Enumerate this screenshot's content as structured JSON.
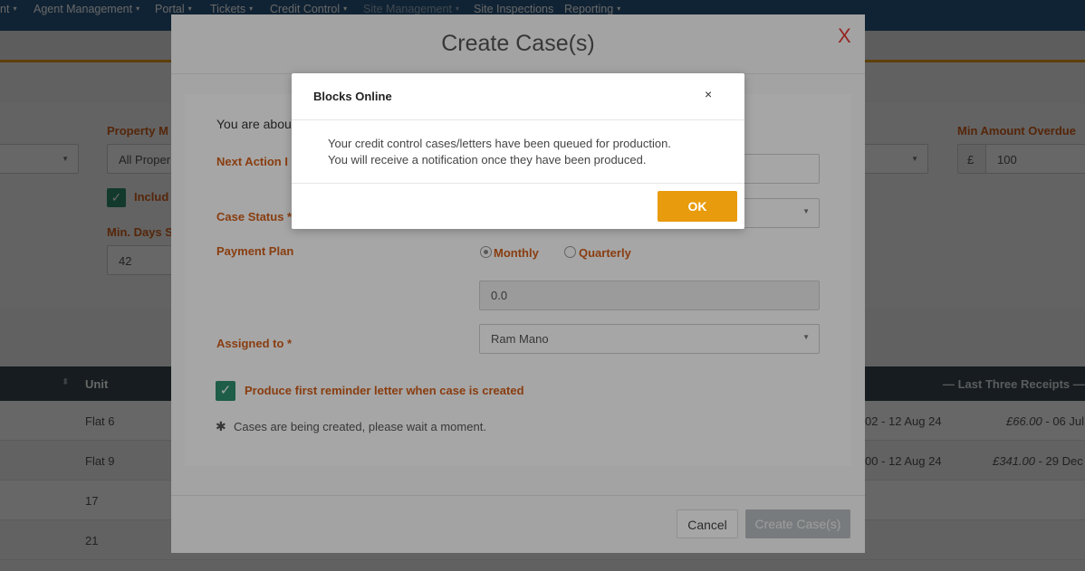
{
  "nav": {
    "items": [
      {
        "label": "nt",
        "dim": false
      },
      {
        "label": "Agent Management",
        "dim": false
      },
      {
        "label": "Portal",
        "dim": false
      },
      {
        "label": "Tickets",
        "dim": false
      },
      {
        "label": "Credit Control",
        "dim": false
      },
      {
        "label": "Site Management",
        "dim": true
      },
      {
        "label": "Site Inspections",
        "dim": false
      },
      {
        "label": "Reporting",
        "dim": false
      }
    ],
    "caret": "▾"
  },
  "filters": {
    "property_manager_label": "Property M",
    "property_manager_value": "All Proper",
    "include_label": "Includ",
    "min_days_label": "Min. Days S",
    "min_days_value": "42",
    "min_amount_label": "Min Amount Overdue",
    "currency_symbol": "£",
    "min_amount_value": "100"
  },
  "table": {
    "headers": {
      "unit": "Unit",
      "last_receipts": "— Last Three Receipts —"
    },
    "rows": [
      {
        "unit": "Flat 6",
        "date_range": "02 - 12 Aug 24",
        "receipt_amount": "£66.00",
        "receipt_date": " - 06 Jul"
      },
      {
        "unit": "Flat 9",
        "date_range": "00 - 12 Aug 24",
        "receipt_amount": "£341.00",
        "receipt_date": " - 29 Dec"
      },
      {
        "unit": "17",
        "date_range": "",
        "receipt_amount": "",
        "receipt_date": ""
      },
      {
        "unit": "21",
        "date_range": "",
        "receipt_amount": "",
        "receipt_date": ""
      }
    ]
  },
  "create_modal": {
    "title": "Create Case(s)",
    "close_label": "X",
    "intro_text": "You are abou",
    "next_action_label": "Next Action I",
    "case_status_label": "Case Status *",
    "payment_plan_label": "Payment Plan",
    "payment_options": [
      {
        "label": "Monthly",
        "selected": true
      },
      {
        "label": "Quarterly",
        "selected": false
      }
    ],
    "payment_amount": "0.0",
    "assigned_to_label": "Assigned to *",
    "assigned_to_value": "Ram Mano",
    "reminder_checkbox_label": "Produce first reminder letter when case is created",
    "reminder_checked": true,
    "status_text": "Cases are being created, please wait a moment.",
    "cancel_label": "Cancel",
    "create_label": "Create Case(s)"
  },
  "dialog": {
    "title": "Blocks Online",
    "close_label": "×",
    "message_line1": "Your credit control cases/letters have been queued for production.",
    "message_line2": "You will receive a notification once they have been produced.",
    "ok_label": "OK"
  },
  "colors": {
    "nav_bg": "#2b5884",
    "accent_orange": "#d35f1a",
    "ok_button": "#e89b0c",
    "checkbox_green": "#2f8f6f",
    "close_red": "#e53935",
    "table_header": "#37474f"
  }
}
